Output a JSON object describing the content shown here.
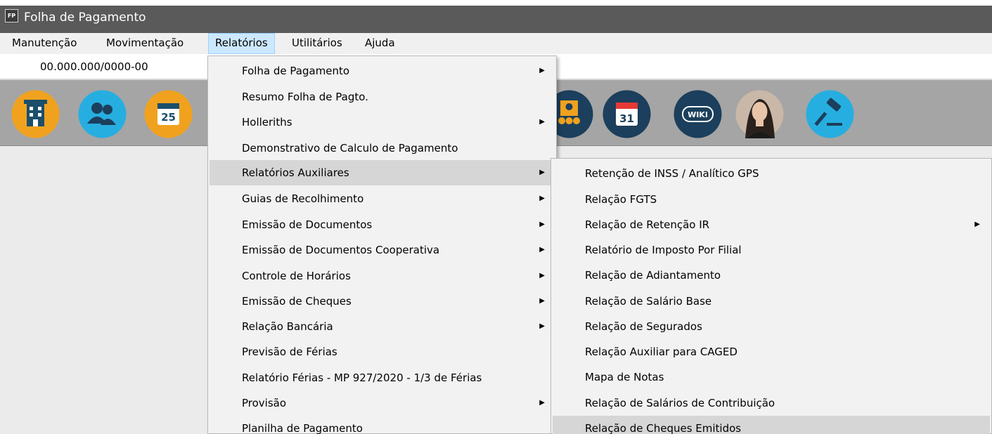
{
  "window": {
    "title": "Folha de Pagamento",
    "app_icon_text": "FP"
  },
  "menubar": [
    {
      "label": "Manutenção"
    },
    {
      "label": "Movimentação"
    },
    {
      "label": "Relatórios"
    },
    {
      "label": "Utilitários"
    },
    {
      "label": "Ajuda"
    }
  ],
  "company": {
    "cnpj": "00.000.000/0000-00"
  },
  "toolbar": {
    "icons": [
      "company-icon",
      "employees-icon",
      "calendar-25-icon",
      "staff-badge-icon",
      "calendar-31-icon",
      "wiki-icon",
      "assistant-avatar-icon",
      "gavel-icon"
    ],
    "calendar_day": "25",
    "calendar_day_2": "31",
    "wiki_text": "WIKI"
  },
  "relatorios_menu": {
    "items": [
      {
        "label": "Folha de Pagamento",
        "submenu": true
      },
      {
        "label": "Resumo Folha de Pagto.",
        "submenu": false
      },
      {
        "label": "Holleriths",
        "submenu": true
      },
      {
        "label": "Demonstrativo de Calculo de Pagamento",
        "submenu": false
      },
      {
        "label": "Relatórios Auxiliares",
        "submenu": true,
        "highlighted": true
      },
      {
        "label": "Guias de Recolhimento",
        "submenu": true
      },
      {
        "label": "Emissão de Documentos",
        "submenu": true
      },
      {
        "label": "Emissão de Documentos Cooperativa",
        "submenu": true
      },
      {
        "label": "Controle de Horários",
        "submenu": true
      },
      {
        "label": "Emissão de Cheques",
        "submenu": true
      },
      {
        "label": "Relação Bancária",
        "submenu": true
      },
      {
        "label": "Previsão de Férias",
        "submenu": false
      },
      {
        "label": "Relatório Férias - MP 927/2020 - 1/3 de Férias",
        "submenu": false
      },
      {
        "label": "Provisão",
        "submenu": true
      },
      {
        "label": "Planilha de Pagamento",
        "submenu": false
      }
    ]
  },
  "auxiliares_menu": {
    "items": [
      {
        "label": "Retenção de INSS / Analítico GPS",
        "submenu": false
      },
      {
        "label": "Relação FGTS",
        "submenu": false
      },
      {
        "label": "Relação de Retenção IR",
        "submenu": true
      },
      {
        "label": "Relatório de Imposto Por Filial",
        "submenu": false
      },
      {
        "label": "Relação de Adiantamento",
        "submenu": false
      },
      {
        "label": "Relação de Salário Base",
        "submenu": false
      },
      {
        "label": "Relação de Segurados",
        "submenu": false
      },
      {
        "label": "Relação Auxiliar para CAGED",
        "submenu": false
      },
      {
        "label": "Mapa de Notas",
        "submenu": false
      },
      {
        "label": "Relação de Salários de Contribuição",
        "submenu": false
      },
      {
        "label": "Relação de Cheques Emitidos",
        "submenu": false,
        "highlighted": true
      }
    ]
  },
  "colors": {
    "titlebar": "#5a5a5a",
    "toolbar": "#a5a5a5",
    "menu_active": "#cce8ff",
    "menu_highlight": "#d6d6d6"
  }
}
